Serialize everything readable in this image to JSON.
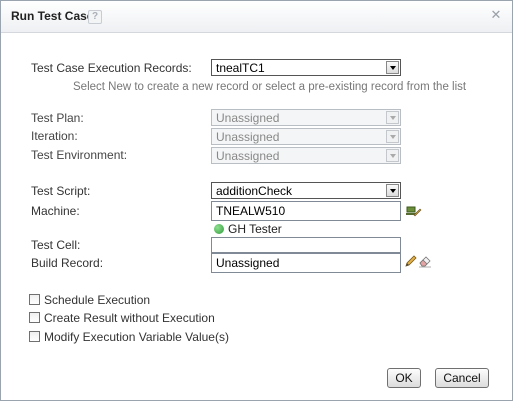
{
  "dialog": {
    "title": "Run Test Case",
    "help_icon": "?",
    "close_icon": "✕"
  },
  "form": {
    "execution_records": {
      "label": "Test Case Execution Records:",
      "value": "tnealTC1",
      "hint": "Select New to create a new record or select a pre-existing record from the list"
    },
    "test_plan": {
      "label": "Test Plan:",
      "value": "Unassigned"
    },
    "iteration": {
      "label": "Iteration:",
      "value": "Unassigned"
    },
    "test_environment": {
      "label": "Test Environment:",
      "value": "Unassigned"
    },
    "test_script": {
      "label": "Test Script:",
      "value": "additionCheck"
    },
    "machine": {
      "label": "Machine:",
      "value": "TNEALW510",
      "status_text": "GH Tester",
      "status_color": "#2e9a3a"
    },
    "test_cell": {
      "label": "Test Cell:",
      "value": ""
    },
    "build_record": {
      "label": "Build Record:",
      "value": "Unassigned"
    }
  },
  "options": {
    "schedule_execution": "Schedule Execution",
    "create_result": "Create Result without Execution",
    "modify_variables": "Modify Execution Variable Value(s)"
  },
  "buttons": {
    "ok": "OK",
    "cancel": "Cancel"
  }
}
